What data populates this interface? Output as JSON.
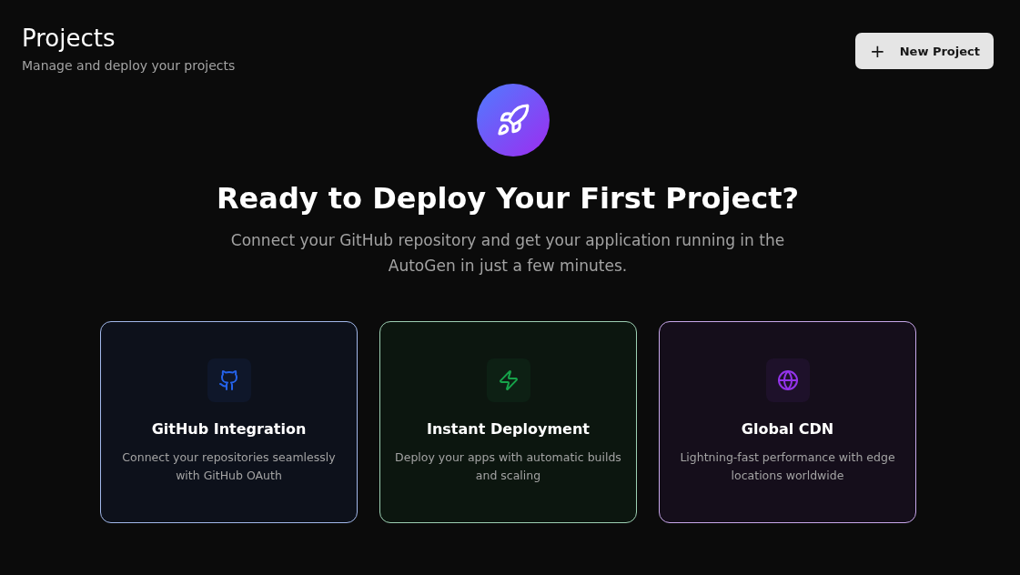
{
  "header": {
    "title": "Projects",
    "subtitle": "Manage and deploy your projects",
    "button": {
      "icon": "+",
      "label": "New Project"
    }
  },
  "hero": {
    "heading": "Ready to Deploy Your First Project?",
    "text": "Connect your GitHub repository and get your application running in the AutoGen in just a few minutes."
  },
  "features": [
    {
      "kind": "github",
      "title": "GitHub Integration",
      "text": "Connect your repositories seamlessly with GitHub OAuth",
      "color": "#2563eb"
    },
    {
      "kind": "bolt",
      "title": "Instant Deployment",
      "text": "Deploy your apps with automatic builds and scaling",
      "color": "#16a34a"
    },
    {
      "kind": "globe",
      "title": "Global CDN",
      "text": "Lightning-fast performance with edge locations worldwide",
      "color": "#9333ea"
    }
  ]
}
